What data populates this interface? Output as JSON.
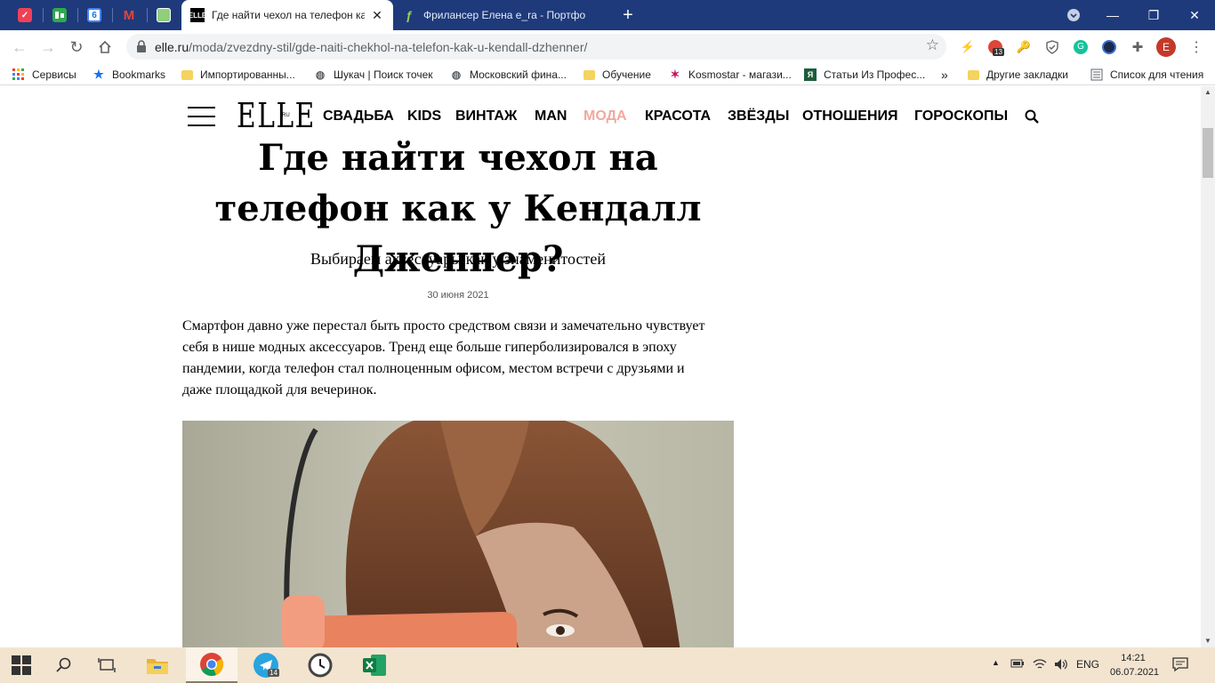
{
  "browser": {
    "tabs": [
      {
        "title": "Где найти чехол на телефон как",
        "active": true
      },
      {
        "title": "Фрилансер Елена e_ra - Портфо",
        "active": false
      }
    ],
    "pinned_tabs": [
      "pocket-icon",
      "trello-icon",
      "google-calendar-icon",
      "gmail-icon",
      "wallet-icon"
    ],
    "url_host": "elle.ru",
    "url_path": "/moda/zvezdny-stil/gde-naiti-chekhol-na-telefon-kak-u-kendall-dzhenner/",
    "extension_badge": "13",
    "profile_initial": "E"
  },
  "bookmarks": [
    {
      "label": "Сервисы",
      "icon": "apps-grid-icon"
    },
    {
      "label": "Bookmarks",
      "icon": "star-icon"
    },
    {
      "label": "Импортированны...",
      "icon": "folder-icon"
    },
    {
      "label": "Шукач | Поиск точек",
      "icon": "globe-icon"
    },
    {
      "label": "Московский фина...",
      "icon": "globe-icon"
    },
    {
      "label": "Обучение",
      "icon": "folder-icon"
    },
    {
      "label": "Kosmostar - магази...",
      "icon": "kosmostar-icon"
    },
    {
      "label": "Статьи Из Профес...",
      "icon": "yandex-icon"
    }
  ],
  "bookmarks_more": "»",
  "bookmarks_other": "Другие закладки",
  "reading_list": "Список для чтения",
  "site": {
    "logo": "ELLE",
    "logo_suffix": "RU",
    "menu": [
      {
        "label": "СВАДЬБА",
        "active": false
      },
      {
        "label": "KIDS",
        "active": false
      },
      {
        "label": "ВИНТАЖ",
        "active": false
      },
      {
        "label": "MAN",
        "active": false
      },
      {
        "label": "МОДА",
        "active": true
      },
      {
        "label": "КРАСОТА",
        "active": false
      },
      {
        "label": "ЗВЁЗДЫ",
        "active": false
      },
      {
        "label": "ОТНОШЕНИЯ",
        "active": false
      },
      {
        "label": "ГОРОСКОПЫ",
        "active": false
      }
    ],
    "accent_color": "#f1a99e"
  },
  "article": {
    "title": "Где найти чехол на телефон как у Кендалл Дженнер?",
    "subtitle": "Выбираем аксессуары как у знаменитостей",
    "date": "30 июня 2021",
    "lead": "Смартфон давно уже перестал быть просто средством связи и замечательно чувствует себя в нише модных аксессуаров. Тренд еще больше гиперболизировался в эпоху пандемии, когда телефон стал полноценным офисом, местом встречи с друзьями и даже площадкой для вечеринок."
  },
  "taskbar": {
    "apps": [
      "windows-start-icon",
      "search-icon",
      "task-view-icon",
      "file-explorer-icon",
      "chrome-icon",
      "telegram-icon",
      "clock-app-icon",
      "excel-icon"
    ],
    "telegram_badge": "14",
    "language": "ENG",
    "time": "14:21",
    "date": "06.07.2021"
  }
}
